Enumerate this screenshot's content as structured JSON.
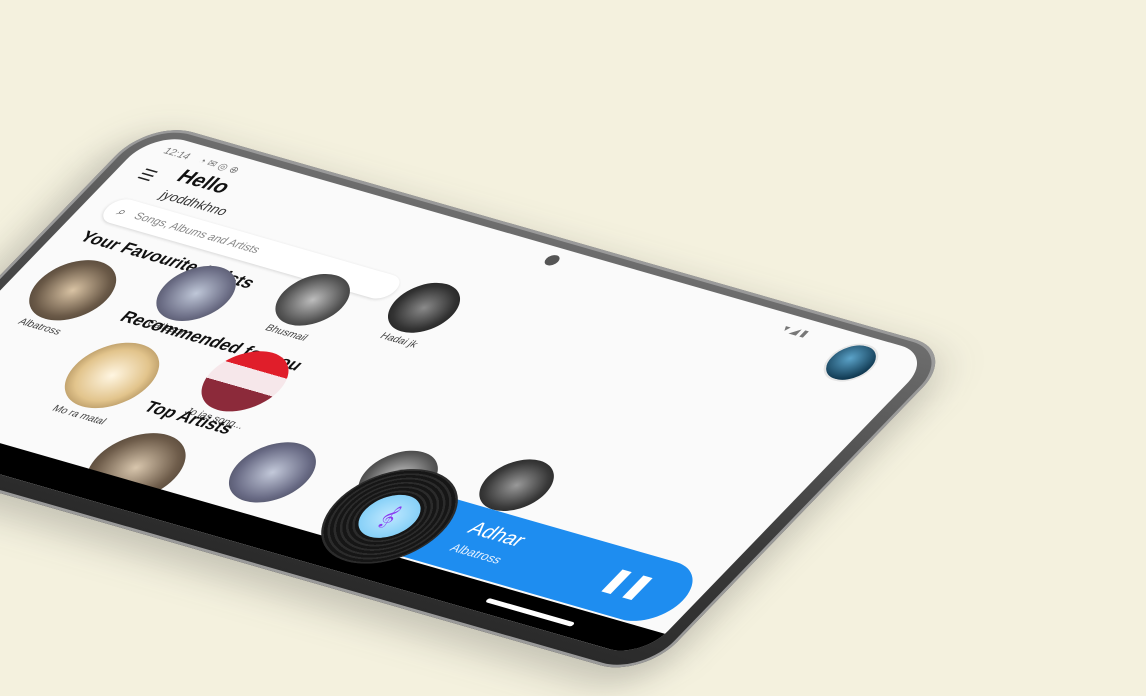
{
  "status": {
    "time": "12:14",
    "indicators": "◔ ✉ ◎ ⊕",
    "right": "▾ ◢ ▮"
  },
  "header": {
    "greeting": "Hello",
    "username": "jyoddhkhno",
    "menu_icon": "menu-icon"
  },
  "search": {
    "placeholder": "Songs, Albums and Artists"
  },
  "sections": {
    "favourite_artists": {
      "title": "Your Favourite Artists",
      "items": [
        "Albatross",
        "Catleson",
        "Bhusmail",
        "Hadai jk"
      ]
    },
    "recommended": {
      "title": "Recommended for you",
      "items": [
        "Mo ra matal",
        "Jo jas song..."
      ]
    },
    "top_artists": {
      "title": "Top Artists",
      "items": [
        "",
        "",
        "",
        ""
      ]
    }
  },
  "now_playing": {
    "title": "Adhar",
    "artist": "Albatross",
    "pause_icon": "pause-icon"
  },
  "colors": {
    "accent": "#1e8df0",
    "background": "#f4f1de"
  }
}
